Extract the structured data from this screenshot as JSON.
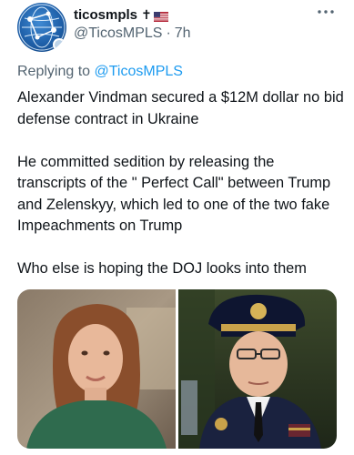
{
  "tweet": {
    "display_name": "ticosmpls",
    "name_suffix_cross": "✝",
    "handle": "@TicosMPLS",
    "separator": "·",
    "timestamp": "7h",
    "reply_prefix": "Replying to",
    "reply_to": "@TicosMPLS",
    "paragraphs": [
      "Alexander Vindman secured a $12M dollar no bid defense contract in Ukraine",
      "He committed sedition by releasing the transcripts of the \" Perfect Call\" between Trump and Zelenskyy, which led to one of the two fake Impeachments on Trump",
      "Who else is hoping the DOJ looks into them"
    ],
    "icons": {
      "avatar": "globe-avatar-icon",
      "flag": "us-flag-icon",
      "more": "more-options-icon"
    },
    "colors": {
      "link": "#1d9bf0",
      "secondary_text": "#536471",
      "primary_text": "#0f1419"
    }
  }
}
